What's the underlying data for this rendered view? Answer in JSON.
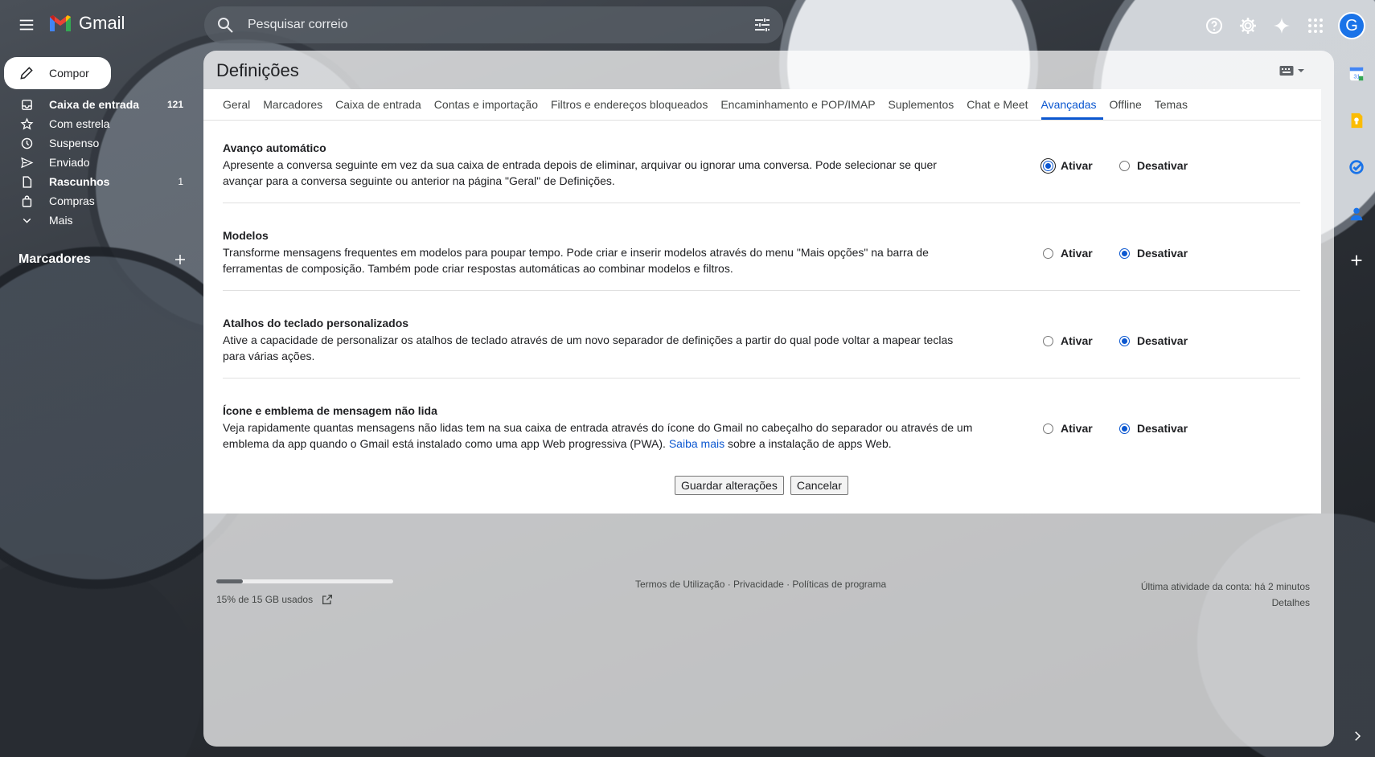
{
  "header": {
    "app_name": "Gmail",
    "search_placeholder": "Pesquisar correio",
    "avatar_letter": "G"
  },
  "sidebar": {
    "compose_label": "Compor",
    "items": [
      {
        "label": "Caixa de entrada",
        "count": "121",
        "icon": "inbox-icon",
        "bold": true
      },
      {
        "label": "Com estrela",
        "count": "",
        "icon": "star-icon",
        "bold": false
      },
      {
        "label": "Suspenso",
        "count": "",
        "icon": "clock-icon",
        "bold": false
      },
      {
        "label": "Enviado",
        "count": "",
        "icon": "send-icon",
        "bold": false
      },
      {
        "label": "Rascunhos",
        "count": "1",
        "icon": "draft-icon",
        "bold": true
      },
      {
        "label": "Compras",
        "count": "",
        "icon": "shopping-icon",
        "bold": false
      },
      {
        "label": "Mais",
        "count": "",
        "icon": "chevron-down-icon",
        "bold": false
      }
    ],
    "labels_heading": "Marcadores"
  },
  "settings": {
    "title": "Definições",
    "tabs": [
      {
        "label": "Geral",
        "active": false
      },
      {
        "label": "Marcadores",
        "active": false
      },
      {
        "label": "Caixa de entrada",
        "active": false
      },
      {
        "label": "Contas e importação",
        "active": false
      },
      {
        "label": "Filtros e endereços bloqueados",
        "active": false
      },
      {
        "label": "Encaminhamento e POP/IMAP",
        "active": false
      },
      {
        "label": "Suplementos",
        "active": false
      },
      {
        "label": "Chat e Meet",
        "active": false
      },
      {
        "label": "Avançadas",
        "active": true
      },
      {
        "label": "Offline",
        "active": false
      },
      {
        "label": "Temas",
        "active": false
      }
    ],
    "option_on": "Ativar",
    "option_off": "Desativar",
    "items": [
      {
        "title": "Avanço automático",
        "description": "Apresente a conversa seguinte em vez da sua caixa de entrada depois de eliminar, arquivar ou ignorar uma conversa. Pode selecionar se quer avançar para a conversa seguinte ou anterior na página \"Geral\" de Definições.",
        "selected": "Ativar"
      },
      {
        "title": "Modelos",
        "description": "Transforme mensagens frequentes em modelos para poupar tempo. Pode criar e inserir modelos através do menu \"Mais opções\" na barra de ferramentas de composição. Também pode criar respostas automáticas ao combinar modelos e filtros.",
        "selected": "Desativar"
      },
      {
        "title": "Atalhos do teclado personalizados",
        "description": "Ative a capacidade de personalizar os atalhos de teclado através de um novo separador de definições a partir do qual pode voltar a mapear teclas para várias ações.",
        "selected": "Desativar"
      },
      {
        "title": "Ícone e emblema de mensagem não lida",
        "description_before_link": "Veja rapidamente quantas mensagens não lidas tem na sua caixa de entrada através do ícone do Gmail no cabeçalho do separador ou através de um emblema da app quando o Gmail está instalado como uma app Web progressiva (PWA). ",
        "link_text": "Saiba mais",
        "description_after_link": " sobre a instalação de apps Web.",
        "selected": "Desativar"
      }
    ],
    "save_label": "Guardar alterações",
    "cancel_label": "Cancelar"
  },
  "footer": {
    "storage_text": "15% de 15 GB usados",
    "storage_used_fraction": 0.15,
    "links": "Termos de Utilização · Privacidade · Políticas de programa",
    "last_activity": "Última atividade da conta: há 2 minutos",
    "details": "Detalhes"
  },
  "colors": {
    "accent": "#0b57d0",
    "avatar": "#1a73e8"
  }
}
